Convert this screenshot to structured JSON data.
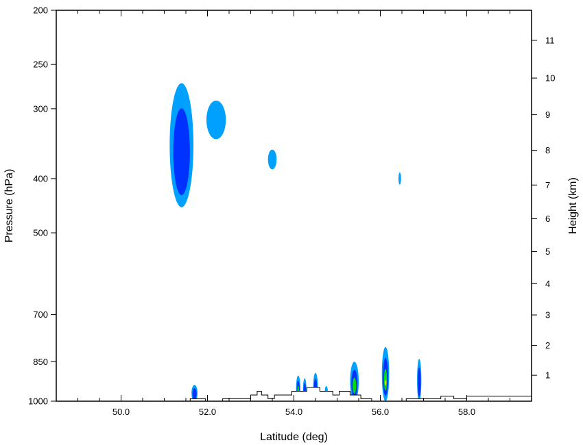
{
  "chart_data": {
    "type": "contour",
    "xlabel": "Latitude (deg)",
    "ylabel": "Pressure (hPa)",
    "y2label": "Height (km)",
    "xlim": [
      48.5,
      59.5
    ],
    "ylim_pressure": [
      1000,
      200
    ],
    "y_scale": "log",
    "x_ticks": [
      50.0,
      52.0,
      54.0,
      56.0,
      58.0
    ],
    "x_tick_labels": [
      "50.0",
      "52.0",
      "54.0",
      "56.0",
      "58.0"
    ],
    "y_ticks": [
      200,
      250,
      300,
      400,
      500,
      700,
      850,
      1000
    ],
    "y_tick_labels": [
      "200",
      "250",
      "300",
      "400",
      "500",
      "700",
      "850",
      "1000"
    ],
    "y2_ticks_km": [
      1,
      2,
      3,
      4,
      5,
      6,
      7,
      8,
      9,
      10,
      11
    ],
    "y2_tick_labels": [
      "1",
      "2",
      "3",
      "4",
      "5",
      "6",
      "7",
      "8",
      "9",
      "10",
      "11"
    ],
    "grid": false,
    "level_colors": [
      "#00a0ff",
      "#0032ff",
      "#00e000",
      "#e6e600"
    ],
    "cells": [
      {
        "lat": 51.4,
        "width": 0.55,
        "p_top": 270,
        "p_bottom": 450,
        "max_level": 1
      },
      {
        "lat": 52.2,
        "width": 0.45,
        "p_top": 290,
        "p_bottom": 340,
        "max_level": 0
      },
      {
        "lat": 53.5,
        "width": 0.2,
        "p_top": 355,
        "p_bottom": 385,
        "max_level": 0
      },
      {
        "lat": 56.45,
        "width": 0.06,
        "p_top": 390,
        "p_bottom": 410,
        "max_level": 0
      },
      {
        "lat": 51.7,
        "width": 0.14,
        "p_top": 935,
        "p_bottom": 1000,
        "max_level": 1
      },
      {
        "lat": 54.1,
        "width": 0.1,
        "p_top": 900,
        "p_bottom": 1000,
        "max_level": 2
      },
      {
        "lat": 54.25,
        "width": 0.08,
        "p_top": 910,
        "p_bottom": 1000,
        "max_level": 1
      },
      {
        "lat": 54.5,
        "width": 0.11,
        "p_top": 890,
        "p_bottom": 1000,
        "max_level": 1
      },
      {
        "lat": 54.75,
        "width": 0.08,
        "p_top": 940,
        "p_bottom": 1000,
        "max_level": 0
      },
      {
        "lat": 55.4,
        "width": 0.2,
        "p_top": 850,
        "p_bottom": 1000,
        "max_level": 2
      },
      {
        "lat": 56.12,
        "width": 0.17,
        "p_top": 800,
        "p_bottom": 1000,
        "max_level": 3
      },
      {
        "lat": 56.9,
        "width": 0.1,
        "p_top": 840,
        "p_bottom": 1000,
        "max_level": 1
      }
    ],
    "terrain_profile": [
      [
        48.5,
        1000
      ],
      [
        51.6,
        1000
      ],
      [
        51.6,
        990
      ],
      [
        51.95,
        990
      ],
      [
        51.95,
        1000
      ],
      [
        52.35,
        1000
      ],
      [
        52.35,
        990
      ],
      [
        53.0,
        990
      ],
      [
        53.0,
        975
      ],
      [
        53.15,
        975
      ],
      [
        53.15,
        960
      ],
      [
        53.25,
        960
      ],
      [
        53.25,
        975
      ],
      [
        53.4,
        975
      ],
      [
        53.4,
        990
      ],
      [
        53.55,
        990
      ],
      [
        53.55,
        975
      ],
      [
        53.95,
        975
      ],
      [
        53.95,
        960
      ],
      [
        54.3,
        960
      ],
      [
        54.3,
        945
      ],
      [
        54.6,
        945
      ],
      [
        54.6,
        960
      ],
      [
        54.9,
        960
      ],
      [
        54.9,
        975
      ],
      [
        55.05,
        975
      ],
      [
        55.05,
        960
      ],
      [
        55.3,
        960
      ],
      [
        55.3,
        975
      ],
      [
        55.55,
        975
      ],
      [
        55.55,
        990
      ],
      [
        55.8,
        990
      ],
      [
        55.8,
        1000
      ],
      [
        56.6,
        1000
      ],
      [
        56.6,
        990
      ],
      [
        57.4,
        990
      ],
      [
        57.4,
        980
      ],
      [
        57.7,
        980
      ],
      [
        57.7,
        990
      ],
      [
        58.0,
        990
      ],
      [
        58.0,
        980
      ],
      [
        59.5,
        980
      ]
    ]
  }
}
